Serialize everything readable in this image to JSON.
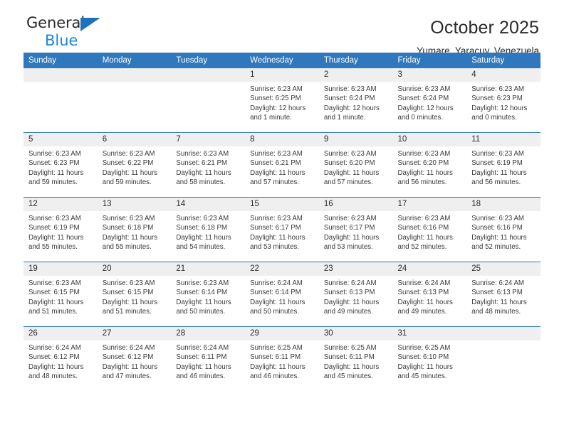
{
  "brand": {
    "line1": "General",
    "line2": "Blue",
    "triangle_color": "#1e72bd",
    "text_color": "#2b2b2b",
    "blue_text_color": "#1e86d6"
  },
  "header": {
    "title": "October 2025",
    "subtitle": "Yumare, Yaracuy, Venezuela"
  },
  "theme": {
    "header_blue": "#2f78bd",
    "daynum_gray": "#efefef",
    "page_background": "#ffffff"
  },
  "weekdays": [
    "Sunday",
    "Monday",
    "Tuesday",
    "Wednesday",
    "Thursday",
    "Friday",
    "Saturday"
  ],
  "weeks": [
    [
      {
        "day": "",
        "empty": true
      },
      {
        "day": "",
        "empty": true
      },
      {
        "day": "",
        "empty": true
      },
      {
        "day": "1",
        "sunrise": "Sunrise: 6:23 AM",
        "sunset": "Sunset: 6:25 PM",
        "daylight": "Daylight: 12 hours and 1 minute."
      },
      {
        "day": "2",
        "sunrise": "Sunrise: 6:23 AM",
        "sunset": "Sunset: 6:24 PM",
        "daylight": "Daylight: 12 hours and 1 minute."
      },
      {
        "day": "3",
        "sunrise": "Sunrise: 6:23 AM",
        "sunset": "Sunset: 6:24 PM",
        "daylight": "Daylight: 12 hours and 0 minutes."
      },
      {
        "day": "4",
        "sunrise": "Sunrise: 6:23 AM",
        "sunset": "Sunset: 6:23 PM",
        "daylight": "Daylight: 12 hours and 0 minutes."
      }
    ],
    [
      {
        "day": "5",
        "sunrise": "Sunrise: 6:23 AM",
        "sunset": "Sunset: 6:23 PM",
        "daylight": "Daylight: 11 hours and 59 minutes."
      },
      {
        "day": "6",
        "sunrise": "Sunrise: 6:23 AM",
        "sunset": "Sunset: 6:22 PM",
        "daylight": "Daylight: 11 hours and 59 minutes."
      },
      {
        "day": "7",
        "sunrise": "Sunrise: 6:23 AM",
        "sunset": "Sunset: 6:21 PM",
        "daylight": "Daylight: 11 hours and 58 minutes."
      },
      {
        "day": "8",
        "sunrise": "Sunrise: 6:23 AM",
        "sunset": "Sunset: 6:21 PM",
        "daylight": "Daylight: 11 hours and 57 minutes."
      },
      {
        "day": "9",
        "sunrise": "Sunrise: 6:23 AM",
        "sunset": "Sunset: 6:20 PM",
        "daylight": "Daylight: 11 hours and 57 minutes."
      },
      {
        "day": "10",
        "sunrise": "Sunrise: 6:23 AM",
        "sunset": "Sunset: 6:20 PM",
        "daylight": "Daylight: 11 hours and 56 minutes."
      },
      {
        "day": "11",
        "sunrise": "Sunrise: 6:23 AM",
        "sunset": "Sunset: 6:19 PM",
        "daylight": "Daylight: 11 hours and 56 minutes."
      }
    ],
    [
      {
        "day": "12",
        "sunrise": "Sunrise: 6:23 AM",
        "sunset": "Sunset: 6:19 PM",
        "daylight": "Daylight: 11 hours and 55 minutes."
      },
      {
        "day": "13",
        "sunrise": "Sunrise: 6:23 AM",
        "sunset": "Sunset: 6:18 PM",
        "daylight": "Daylight: 11 hours and 55 minutes."
      },
      {
        "day": "14",
        "sunrise": "Sunrise: 6:23 AM",
        "sunset": "Sunset: 6:18 PM",
        "daylight": "Daylight: 11 hours and 54 minutes."
      },
      {
        "day": "15",
        "sunrise": "Sunrise: 6:23 AM",
        "sunset": "Sunset: 6:17 PM",
        "daylight": "Daylight: 11 hours and 53 minutes."
      },
      {
        "day": "16",
        "sunrise": "Sunrise: 6:23 AM",
        "sunset": "Sunset: 6:17 PM",
        "daylight": "Daylight: 11 hours and 53 minutes."
      },
      {
        "day": "17",
        "sunrise": "Sunrise: 6:23 AM",
        "sunset": "Sunset: 6:16 PM",
        "daylight": "Daylight: 11 hours and 52 minutes."
      },
      {
        "day": "18",
        "sunrise": "Sunrise: 6:23 AM",
        "sunset": "Sunset: 6:16 PM",
        "daylight": "Daylight: 11 hours and 52 minutes."
      }
    ],
    [
      {
        "day": "19",
        "sunrise": "Sunrise: 6:23 AM",
        "sunset": "Sunset: 6:15 PM",
        "daylight": "Daylight: 11 hours and 51 minutes."
      },
      {
        "day": "20",
        "sunrise": "Sunrise: 6:23 AM",
        "sunset": "Sunset: 6:15 PM",
        "daylight": "Daylight: 11 hours and 51 minutes."
      },
      {
        "day": "21",
        "sunrise": "Sunrise: 6:23 AM",
        "sunset": "Sunset: 6:14 PM",
        "daylight": "Daylight: 11 hours and 50 minutes."
      },
      {
        "day": "22",
        "sunrise": "Sunrise: 6:24 AM",
        "sunset": "Sunset: 6:14 PM",
        "daylight": "Daylight: 11 hours and 50 minutes."
      },
      {
        "day": "23",
        "sunrise": "Sunrise: 6:24 AM",
        "sunset": "Sunset: 6:13 PM",
        "daylight": "Daylight: 11 hours and 49 minutes."
      },
      {
        "day": "24",
        "sunrise": "Sunrise: 6:24 AM",
        "sunset": "Sunset: 6:13 PM",
        "daylight": "Daylight: 11 hours and 49 minutes."
      },
      {
        "day": "25",
        "sunrise": "Sunrise: 6:24 AM",
        "sunset": "Sunset: 6:13 PM",
        "daylight": "Daylight: 11 hours and 48 minutes."
      }
    ],
    [
      {
        "day": "26",
        "sunrise": "Sunrise: 6:24 AM",
        "sunset": "Sunset: 6:12 PM",
        "daylight": "Daylight: 11 hours and 48 minutes."
      },
      {
        "day": "27",
        "sunrise": "Sunrise: 6:24 AM",
        "sunset": "Sunset: 6:12 PM",
        "daylight": "Daylight: 11 hours and 47 minutes."
      },
      {
        "day": "28",
        "sunrise": "Sunrise: 6:24 AM",
        "sunset": "Sunset: 6:11 PM",
        "daylight": "Daylight: 11 hours and 46 minutes."
      },
      {
        "day": "29",
        "sunrise": "Sunrise: 6:25 AM",
        "sunset": "Sunset: 6:11 PM",
        "daylight": "Daylight: 11 hours and 46 minutes."
      },
      {
        "day": "30",
        "sunrise": "Sunrise: 6:25 AM",
        "sunset": "Sunset: 6:11 PM",
        "daylight": "Daylight: 11 hours and 45 minutes."
      },
      {
        "day": "31",
        "sunrise": "Sunrise: 6:25 AM",
        "sunset": "Sunset: 6:10 PM",
        "daylight": "Daylight: 11 hours and 45 minutes."
      },
      {
        "day": "",
        "empty": true
      }
    ]
  ]
}
